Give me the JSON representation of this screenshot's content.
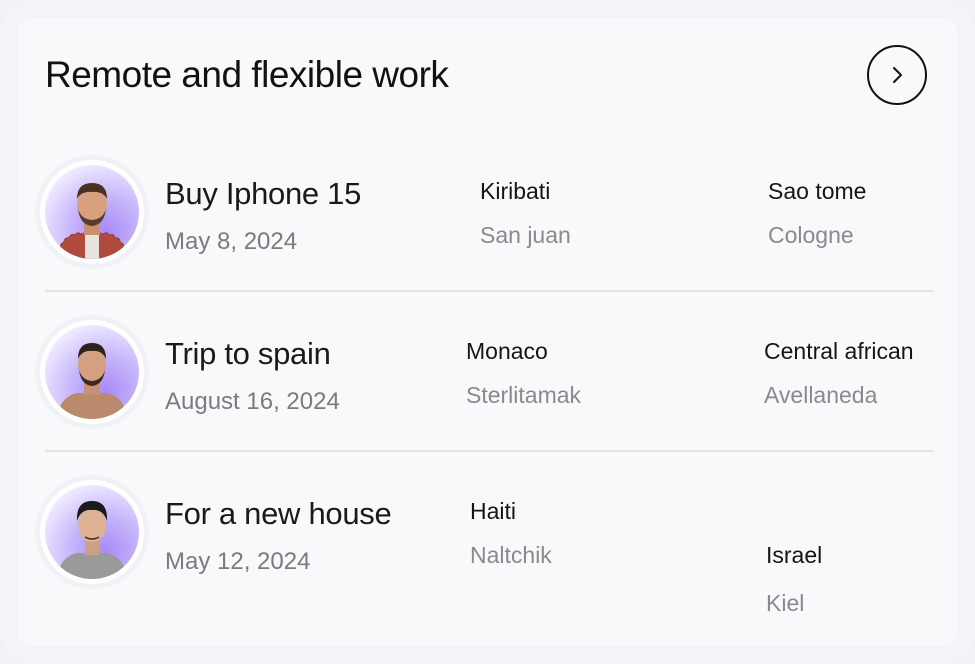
{
  "header": {
    "title": "Remote and flexible work",
    "next_icon": "chevron-right-icon"
  },
  "rows": [
    {
      "name": "Buy Iphone 15",
      "date": "May 8, 2024",
      "col1_top": "Kiribati",
      "col1_bottom": "San juan",
      "col2_top": "Sao tome",
      "col2_bottom": "Cologne",
      "shirt_color": "#b04a3c"
    },
    {
      "name": "Trip to spain",
      "date": "August 16, 2024",
      "col1_top": "Monaco",
      "col1_bottom": "Sterlitamak",
      "col2_top": "Central african",
      "col2_bottom": "Avellaneda",
      "shirt_color": "#b98a6c"
    },
    {
      "name": "For a new house",
      "date": "May 12, 2024",
      "col1_top": "Haiti",
      "col1_bottom": "Naltchik",
      "col2_top": "Israel",
      "col2_bottom": "Kiel",
      "shirt_color": "#9a9a9a"
    }
  ],
  "colors": {
    "accent": "#a88af7",
    "text": "#111111",
    "muted": "#7b7b7f"
  }
}
